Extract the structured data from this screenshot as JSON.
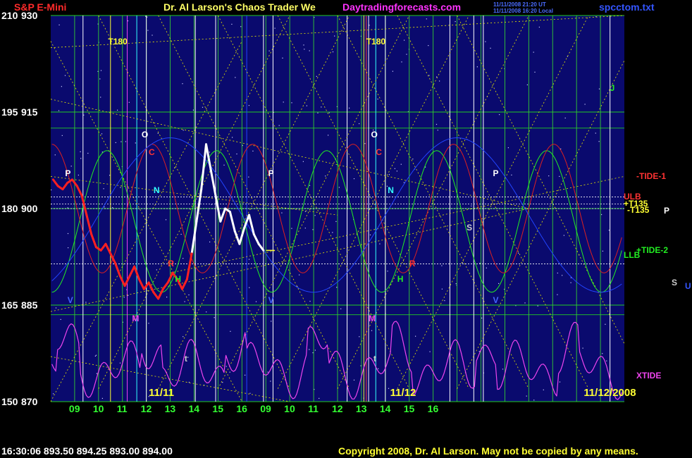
{
  "header": {
    "title": "S&P E-Mini",
    "subtitle": "Dr. Al Larson's Chaos Trader We",
    "url": "Daytradingforecasts.com",
    "timestamp1": "11/11/2008 21:20 UT",
    "timestamp2": "11/11/2008 16:20 Local",
    "file": "spcctom.txt"
  },
  "footer": {
    "quote": "16:30:06  893.50  894.25  893.00  894.00",
    "copyright": "Copyright 2008, Dr. Al Larson. May not be copied by any means."
  },
  "colors": {
    "background": "#000000",
    "plot_bg": "#0a0a6e",
    "price": "#ff2020",
    "price_recent": "#ffffff",
    "green": "#22ee22",
    "red_cycle": "#dd2020",
    "blue": "#2244ff",
    "xtide": "#ee44ee",
    "yellow": "#ffff33"
  },
  "chart_data": {
    "type": "line",
    "title": "S&P E-Mini",
    "y_left_labels": [
      "210",
      "195",
      "180",
      "165",
      "150"
    ],
    "y_right_labels": [
      "930",
      "915",
      "900",
      "885",
      "870"
    ],
    "y_values": [
      930,
      915,
      900,
      885,
      870
    ],
    "ylim": [
      870,
      930
    ],
    "x_tick_labels": [
      "09",
      "10",
      "11",
      "12",
      "13",
      "14",
      "15",
      "16",
      "09",
      "10",
      "11",
      "12",
      "13",
      "14",
      "15",
      "16"
    ],
    "date_labels": [
      "11/11",
      "11/12",
      "11/12/2008"
    ],
    "xlim_hours": [
      8.0,
      32.0
    ],
    "price_series": {
      "name": "E-Mini price",
      "points": [
        [
          8.1,
          904.5
        ],
        [
          8.3,
          903.5
        ],
        [
          8.5,
          903.0
        ],
        [
          8.7,
          904.0
        ],
        [
          8.9,
          904.5
        ],
        [
          9.1,
          903.5
        ],
        [
          9.3,
          902.0
        ],
        [
          9.5,
          899.0
        ],
        [
          9.7,
          896.0
        ],
        [
          9.9,
          894.0
        ],
        [
          10.1,
          893.5
        ],
        [
          10.3,
          894.5
        ],
        [
          10.5,
          893.0
        ],
        [
          10.7,
          891.5
        ],
        [
          10.9,
          889.5
        ],
        [
          11.1,
          888.0
        ],
        [
          11.3,
          889.5
        ],
        [
          11.5,
          891.0
        ],
        [
          11.7,
          889.0
        ],
        [
          11.9,
          887.5
        ],
        [
          12.1,
          888.5
        ],
        [
          12.3,
          887.0
        ],
        [
          12.5,
          886.0
        ],
        [
          12.7,
          887.5
        ],
        [
          12.9,
          888.5
        ],
        [
          13.1,
          890.0
        ],
        [
          13.3,
          889.0
        ],
        [
          13.5,
          887.5
        ],
        [
          13.7,
          889.0
        ],
        [
          13.9,
          893.0
        ],
        [
          14.1,
          898.0
        ],
        [
          14.3,
          903.0
        ],
        [
          14.5,
          910.0
        ],
        [
          14.7,
          906.0
        ],
        [
          14.9,
          902.0
        ],
        [
          15.1,
          898.0
        ],
        [
          15.3,
          900.0
        ],
        [
          15.5,
          899.5
        ],
        [
          15.7,
          896.5
        ],
        [
          15.9,
          894.5
        ],
        [
          16.1,
          897.0
        ],
        [
          16.3,
          899.0
        ],
        [
          16.5,
          896.0
        ],
        [
          16.7,
          894.5
        ],
        [
          16.9,
          893.5
        ]
      ],
      "recent_from_hour": 14.0
    },
    "series": [
      {
        "name": "+TIDE-2",
        "color": "#22ee22"
      },
      {
        "name": "-TIDE-1",
        "color": "#dd2020"
      },
      {
        "name": "XTIDE",
        "color": "#ee44ee"
      }
    ],
    "levels": [
      {
        "name": "ULB",
        "value": 901.8
      },
      {
        "name": "+T135",
        "value": 900.7
      },
      {
        "name": "-T135",
        "value": 900.0
      },
      {
        "name": "LLB",
        "value": 891.4
      }
    ],
    "annotations": [
      {
        "text": "T180",
        "x": 10.4,
        "y": 926.0,
        "color": "#ffff33"
      },
      {
        "text": "T180",
        "x": 21.2,
        "y": 926.0,
        "color": "#ffff33"
      },
      {
        "text": "O",
        "x": 11.8,
        "y": 911.5,
        "color": "#ffffff"
      },
      {
        "text": "O",
        "x": 21.4,
        "y": 911.5,
        "color": "#ffffff"
      },
      {
        "text": "C",
        "x": 12.1,
        "y": 908.8,
        "color": "#ff3333"
      },
      {
        "text": "C",
        "x": 21.6,
        "y": 908.8,
        "color": "#ff3333"
      },
      {
        "text": "N",
        "x": 12.3,
        "y": 902.8,
        "color": "#33ffff"
      },
      {
        "text": "N",
        "x": 22.1,
        "y": 902.8,
        "color": "#33ffff"
      },
      {
        "text": "P",
        "x": 8.6,
        "y": 905.5,
        "color": "#ffffff"
      },
      {
        "text": "P",
        "x": 17.1,
        "y": 905.5,
        "color": "#ffffff"
      },
      {
        "text": "P",
        "x": 26.5,
        "y": 905.5,
        "color": "#ffffff"
      },
      {
        "text": "S",
        "x": 25.4,
        "y": 897.0,
        "color": "#cccccc"
      },
      {
        "text": "R",
        "x": 12.9,
        "y": 891.5,
        "color": "#ff3333"
      },
      {
        "text": "R",
        "x": 23.0,
        "y": 891.5,
        "color": "#ff3333"
      },
      {
        "text": "H",
        "x": 13.2,
        "y": 889.0,
        "color": "#22ee22"
      },
      {
        "text": "H",
        "x": 22.5,
        "y": 889.0,
        "color": "#22ee22"
      },
      {
        "text": "V",
        "x": 8.7,
        "y": 885.8,
        "color": "#4466ff"
      },
      {
        "text": "V",
        "x": 17.1,
        "y": 885.8,
        "color": "#4466ff"
      },
      {
        "text": "V",
        "x": 26.5,
        "y": 885.8,
        "color": "#4466ff"
      },
      {
        "text": "M",
        "x": 11.4,
        "y": 882.9,
        "color": "#ee44ee"
      },
      {
        "text": "M",
        "x": 21.3,
        "y": 882.9,
        "color": "#ee44ee"
      },
      {
        "text": "t",
        "x": 13.6,
        "y": 876.7,
        "color": "#cccccc"
      },
      {
        "text": "t",
        "x": 21.5,
        "y": 876.7,
        "color": "#cccccc"
      },
      {
        "text": "J",
        "x": 31.4,
        "y": 918.7,
        "color": "#22ee22"
      }
    ],
    "right_labels": [
      {
        "text": "-TIDE-1",
        "color": "#ff3333",
        "y": 905.0
      },
      {
        "text": "ULB",
        "color": "#ff3333",
        "y": 901.9
      },
      {
        "text": "+T135",
        "color": "#ffff33",
        "y": 900.8
      },
      {
        "text": "-T135",
        "color": "#ffff33",
        "y": 899.8
      },
      {
        "text": "P",
        "color": "#ffffff",
        "y": 899.7
      },
      {
        "text": "+TIDE-2",
        "color": "#22ee22",
        "y": 893.5
      },
      {
        "text": "LLB",
        "color": "#22ee22",
        "y": 892.8
      },
      {
        "text": "S",
        "color": "#cccccc",
        "y": 888.5
      },
      {
        "text": "U",
        "color": "#3355ff",
        "y": 888.0
      },
      {
        "text": "XTIDE",
        "color": "#ee44ee",
        "y": 874.0
      }
    ],
    "grid": true
  }
}
